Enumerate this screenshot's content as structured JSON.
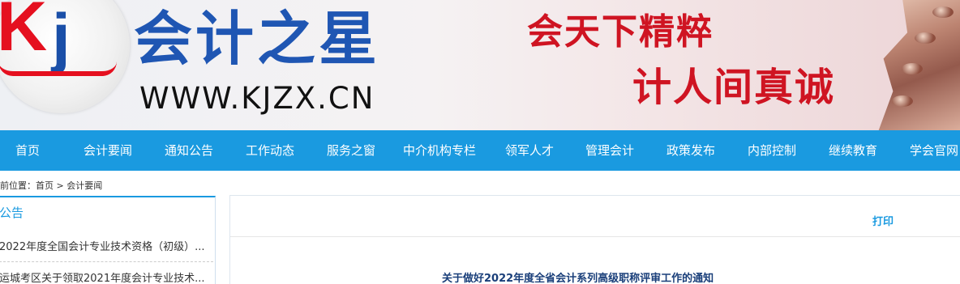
{
  "header": {
    "logo_k": "K",
    "logo_j": "j",
    "brand_name": "会计之星",
    "url": "WWW.KJZX.CN",
    "slogan_line1": "会天下精粹",
    "slogan_line2": "计人间真诚"
  },
  "nav": {
    "items": [
      {
        "label": "首页"
      },
      {
        "label": "会计要闻"
      },
      {
        "label": "通知公告"
      },
      {
        "label": "工作动态"
      },
      {
        "label": "服务之窗"
      },
      {
        "label": "中介机构专栏"
      },
      {
        "label": "领军人才"
      },
      {
        "label": "管理会计"
      },
      {
        "label": "政策发布"
      },
      {
        "label": "内部控制"
      },
      {
        "label": "继续教育"
      },
      {
        "label": "学会官网"
      }
    ]
  },
  "breadcrumb": {
    "prefix": "前位置：",
    "home": "首页",
    "separator": ">",
    "current": "会计要闻"
  },
  "sidebar": {
    "title": "公告",
    "items": [
      {
        "text": "2022年度全国会计专业技术资格（初级）..."
      },
      {
        "text": "运城考区关于领取2021年度会计专业技术..."
      }
    ]
  },
  "content": {
    "print_label": "打印",
    "article_title": "关于做好2022年度全省会计系列高级职称评审工作的通知"
  },
  "colors": {
    "nav_bg": "#1a9ae0",
    "brand_blue": "#1f56b3",
    "slogan_red": "#cf1422",
    "article_title": "#1a3f7a"
  }
}
